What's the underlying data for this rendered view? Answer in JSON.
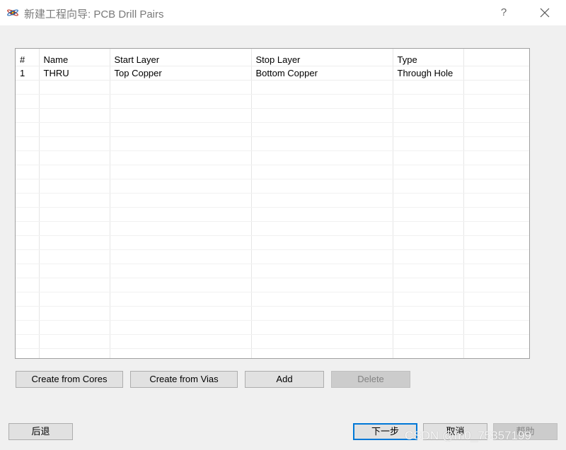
{
  "window": {
    "title": "新建工程向导: PCB Drill Pairs",
    "help_label": "?",
    "icon": "app-logo-icon",
    "close_icon": "close-icon"
  },
  "table": {
    "columns": [
      "#",
      "Name",
      "Start Layer",
      "Stop Layer",
      "Type"
    ],
    "rows": [
      [
        "1",
        "THRU",
        "Top Copper",
        "Bottom Copper",
        "Through Hole"
      ]
    ]
  },
  "actions": {
    "create_from_cores": "Create from Cores",
    "create_from_vias": "Create from Vias",
    "add": "Add",
    "delete": "Delete"
  },
  "footer": {
    "back": "后退",
    "next": "下一步",
    "cancel": "取消",
    "help": "帮助"
  },
  "watermark": "CSDN @m0_75357199",
  "colors": {
    "default_button_border": "#0078d7",
    "disabled_text": "#838383"
  }
}
